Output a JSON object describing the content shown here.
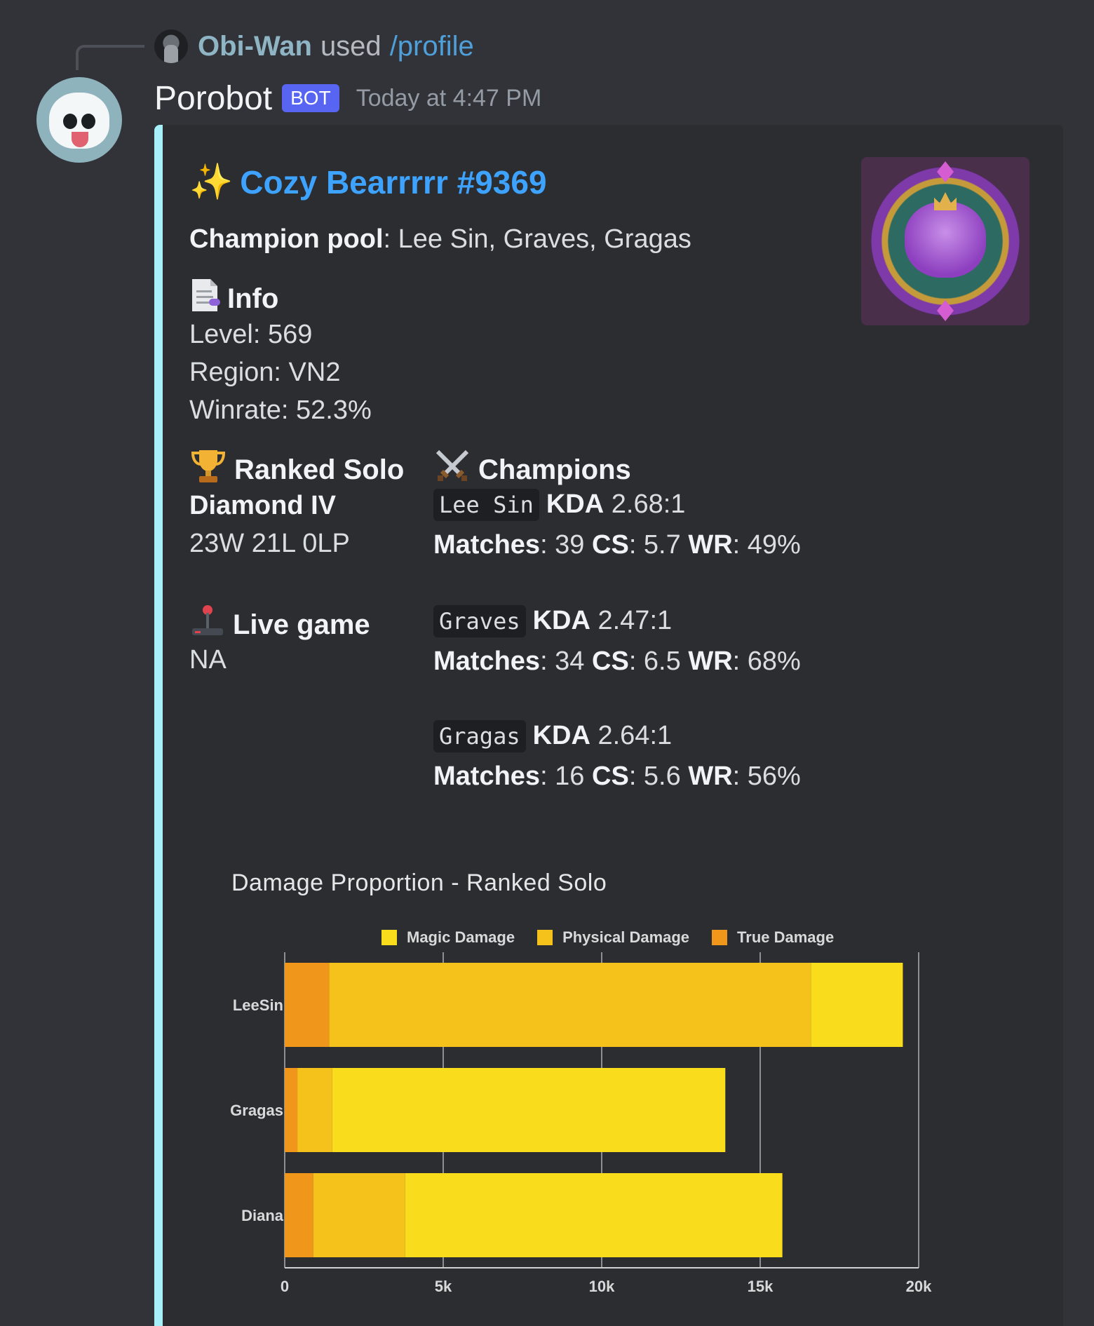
{
  "reply": {
    "user": "Obi-Wan",
    "used": "used",
    "command": "/profile"
  },
  "author": {
    "name": "Porobot",
    "tag": "BOT",
    "timestamp": "Today at 4:47 PM"
  },
  "embed": {
    "title_icon": "sparkles-icon",
    "title": "Cozy Bearrrrr #9369",
    "champion_pool_label": "Champion pool",
    "champion_pool_value": ": Lee Sin, Graves, Gragas",
    "info": {
      "title": "Info",
      "level": "Level: 569",
      "region": "Region: VN2",
      "winrate": "Winrate: 52.3%"
    },
    "ranked": {
      "title": "Ranked Solo",
      "tier": "Diamond IV",
      "record": "23W 21L 0LP"
    },
    "live_game": {
      "title": "Live game",
      "value": "NA"
    },
    "champions_title": "Champions",
    "champions": [
      {
        "name": "Lee Sin",
        "kda_label": "KDA",
        "kda": "2.68:1",
        "matches_label": "Matches",
        "matches": ": 39",
        "cs_label": "CS",
        "cs": ": 5.7",
        "wr_label": "WR",
        "wr": ": 49%"
      },
      {
        "name": "Graves",
        "kda_label": "KDA",
        "kda": "2.47:1",
        "matches_label": "Matches",
        "matches": ": 34",
        "cs_label": "CS",
        "cs": ": 6.5",
        "wr_label": "WR",
        "wr": ": 68%"
      },
      {
        "name": "Gragas",
        "kda_label": "KDA",
        "kda": "2.64:1",
        "matches_label": "Matches",
        "matches": ": 16",
        "cs_label": "CS",
        "cs": ": 5.6",
        "wr_label": "WR",
        "wr": ": 56%"
      }
    ]
  },
  "colors": {
    "accent_bar": "#a7f0fa",
    "title": "#3ea3ff",
    "bot_tag": "#5865f2"
  },
  "chart_data": {
    "type": "bar",
    "orientation": "horizontal",
    "stacked": true,
    "title": "Damage Proportion - Ranked Solo",
    "categories": [
      "LeeSin",
      "Gragas",
      "Diana"
    ],
    "series": [
      {
        "name": "True Damage",
        "color": "#f0961a",
        "values": [
          1400,
          400,
          900
        ]
      },
      {
        "name": "Physical Damage",
        "color": "#f5c21b",
        "values": [
          15200,
          1100,
          2900
        ]
      },
      {
        "name": "Magic Damage",
        "color": "#f9dc1c",
        "values": [
          2900,
          12400,
          11900
        ]
      }
    ],
    "legend_order": [
      "Magic Damage",
      "Physical Damage",
      "True Damage"
    ],
    "legend_position": "top",
    "xlim": [
      0,
      20000
    ],
    "xticks": [
      0,
      5000,
      10000,
      15000,
      20000
    ],
    "xtick_labels": [
      "0",
      "5k",
      "10k",
      "15k",
      "20k"
    ],
    "grid": true
  }
}
